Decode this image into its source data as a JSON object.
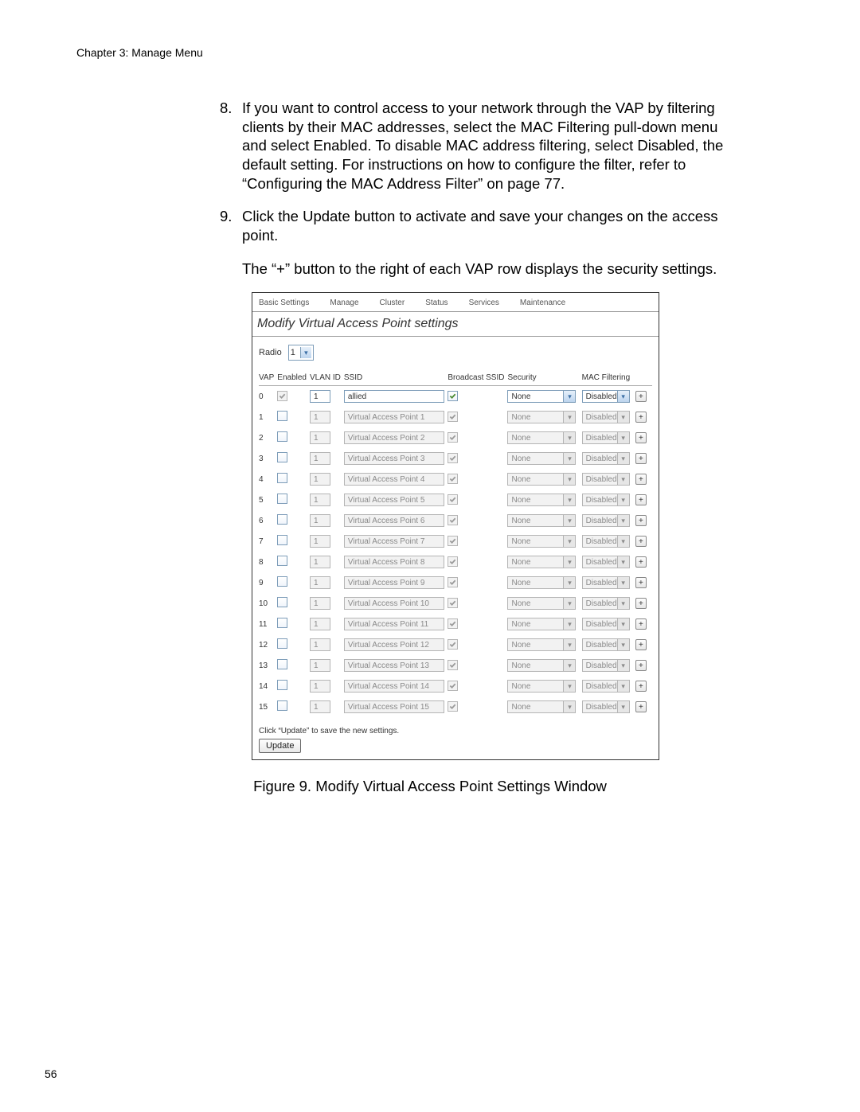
{
  "page": {
    "chapter_header": "Chapter 3: Manage Menu",
    "page_number": "56"
  },
  "body": {
    "item8_num": "8.",
    "item8": "If you want to control access to your network through the VAP by filtering clients by their MAC addresses, select the MAC Filtering pull-down menu and select Enabled. To disable MAC address filtering, select Disabled, the default setting. For instructions on how to configure the filter, refer to “Configuring the MAC Address Filter” on page 77.",
    "item9_num": "9.",
    "item9": "Click the Update button to activate and save your changes on the access point.",
    "item9b": "The “+” button to the right of each VAP row displays the security settings."
  },
  "screenshot": {
    "tabs": [
      "Basic Settings",
      "Manage",
      "Cluster",
      "Status",
      "Services",
      "Maintenance"
    ],
    "title": "Modify Virtual Access Point settings",
    "radio_label": "Radio",
    "radio_value": "1",
    "headers": {
      "vap": "VAP",
      "enabled": "Enabled",
      "vlan": "VLAN ID",
      "ssid": "SSID",
      "bcast": "Broadcast SSID",
      "security": "Security",
      "mac": "MAC Filtering"
    },
    "rows": [
      {
        "vap": "0",
        "enabled": true,
        "locked": true,
        "vlan": "1",
        "ssid": "allied",
        "bcast": true,
        "security": "None",
        "mac": "Disabled",
        "active": true
      },
      {
        "vap": "1",
        "enabled": false,
        "locked": false,
        "vlan": "1",
        "ssid": "Virtual Access Point 1",
        "bcast": true,
        "security": "None",
        "mac": "Disabled",
        "active": false
      },
      {
        "vap": "2",
        "enabled": false,
        "locked": false,
        "vlan": "1",
        "ssid": "Virtual Access Point 2",
        "bcast": true,
        "security": "None",
        "mac": "Disabled",
        "active": false
      },
      {
        "vap": "3",
        "enabled": false,
        "locked": false,
        "vlan": "1",
        "ssid": "Virtual Access Point 3",
        "bcast": true,
        "security": "None",
        "mac": "Disabled",
        "active": false
      },
      {
        "vap": "4",
        "enabled": false,
        "locked": false,
        "vlan": "1",
        "ssid": "Virtual Access Point 4",
        "bcast": true,
        "security": "None",
        "mac": "Disabled",
        "active": false
      },
      {
        "vap": "5",
        "enabled": false,
        "locked": false,
        "vlan": "1",
        "ssid": "Virtual Access Point 5",
        "bcast": true,
        "security": "None",
        "mac": "Disabled",
        "active": false
      },
      {
        "vap": "6",
        "enabled": false,
        "locked": false,
        "vlan": "1",
        "ssid": "Virtual Access Point 6",
        "bcast": true,
        "security": "None",
        "mac": "Disabled",
        "active": false
      },
      {
        "vap": "7",
        "enabled": false,
        "locked": false,
        "vlan": "1",
        "ssid": "Virtual Access Point 7",
        "bcast": true,
        "security": "None",
        "mac": "Disabled",
        "active": false
      },
      {
        "vap": "8",
        "enabled": false,
        "locked": false,
        "vlan": "1",
        "ssid": "Virtual Access Point 8",
        "bcast": true,
        "security": "None",
        "mac": "Disabled",
        "active": false
      },
      {
        "vap": "9",
        "enabled": false,
        "locked": false,
        "vlan": "1",
        "ssid": "Virtual Access Point 9",
        "bcast": true,
        "security": "None",
        "mac": "Disabled",
        "active": false
      },
      {
        "vap": "10",
        "enabled": false,
        "locked": false,
        "vlan": "1",
        "ssid": "Virtual Access Point 10",
        "bcast": true,
        "security": "None",
        "mac": "Disabled",
        "active": false
      },
      {
        "vap": "11",
        "enabled": false,
        "locked": false,
        "vlan": "1",
        "ssid": "Virtual Access Point 11",
        "bcast": true,
        "security": "None",
        "mac": "Disabled",
        "active": false
      },
      {
        "vap": "12",
        "enabled": false,
        "locked": false,
        "vlan": "1",
        "ssid": "Virtual Access Point 12",
        "bcast": true,
        "security": "None",
        "mac": "Disabled",
        "active": false
      },
      {
        "vap": "13",
        "enabled": false,
        "locked": false,
        "vlan": "1",
        "ssid": "Virtual Access Point 13",
        "bcast": true,
        "security": "None",
        "mac": "Disabled",
        "active": false
      },
      {
        "vap": "14",
        "enabled": false,
        "locked": false,
        "vlan": "1",
        "ssid": "Virtual Access Point 14",
        "bcast": true,
        "security": "None",
        "mac": "Disabled",
        "active": false
      },
      {
        "vap": "15",
        "enabled": false,
        "locked": false,
        "vlan": "1",
        "ssid": "Virtual Access Point 15",
        "bcast": true,
        "security": "None",
        "mac": "Disabled",
        "active": false
      }
    ],
    "update_hint": "Click “Update” to save the new settings.",
    "update_label": "Update",
    "plus_glyph": "+"
  },
  "figure_caption": "Figure 9. Modify Virtual Access Point Settings Window"
}
